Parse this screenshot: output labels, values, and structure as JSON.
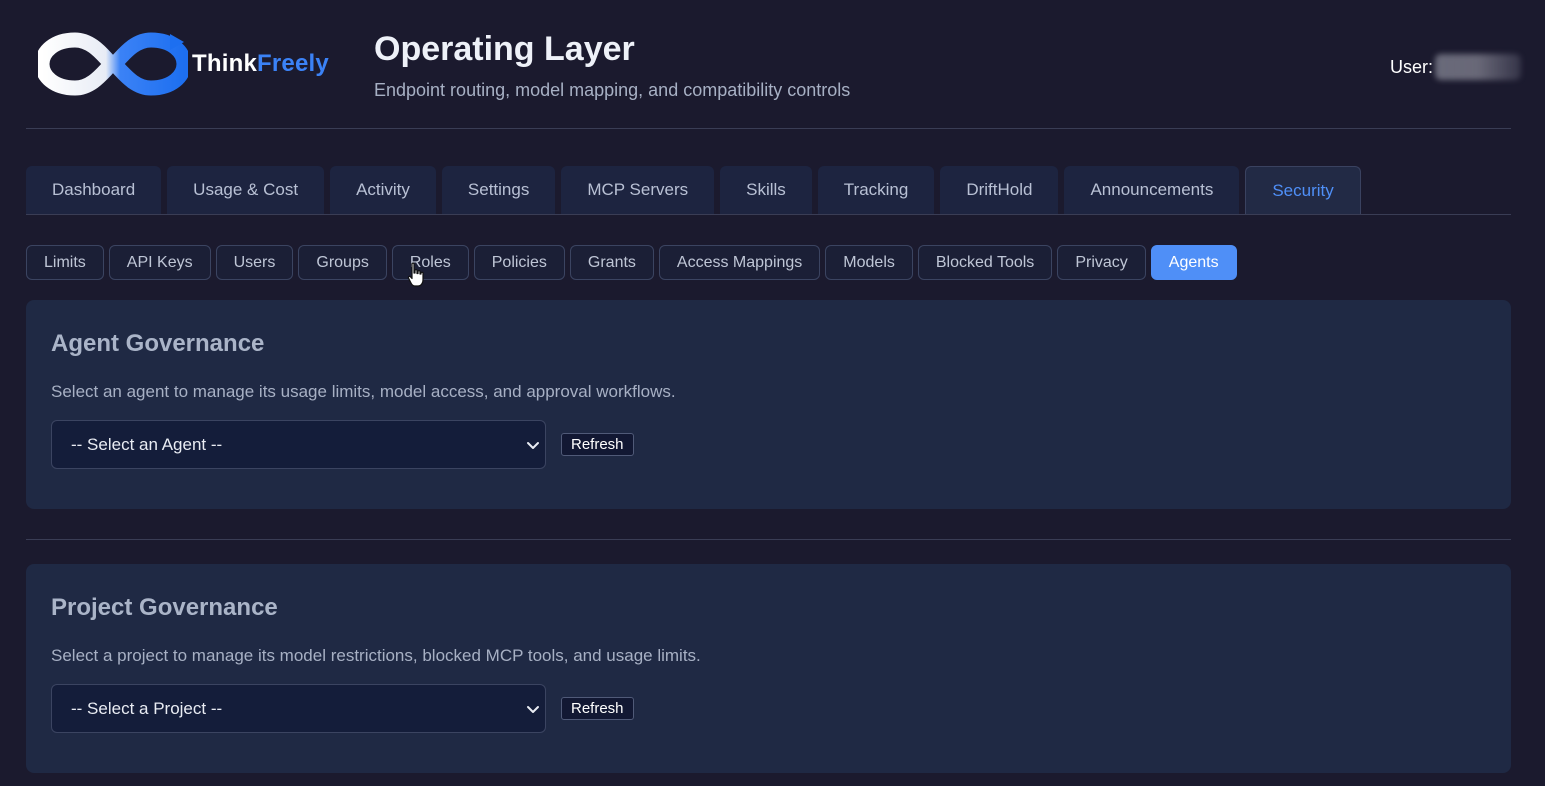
{
  "header": {
    "logo_text_a": "Think",
    "logo_text_b": "Freely",
    "title": "Operating Layer",
    "subtitle": "Endpoint routing, model mapping, and compatibility controls",
    "user_label": "User:"
  },
  "tabs": [
    {
      "label": "Dashboard"
    },
    {
      "label": "Usage & Cost"
    },
    {
      "label": "Activity"
    },
    {
      "label": "Settings"
    },
    {
      "label": "MCP Servers"
    },
    {
      "label": "Skills"
    },
    {
      "label": "Tracking"
    },
    {
      "label": "DriftHold"
    },
    {
      "label": "Announcements"
    },
    {
      "label": "Security"
    }
  ],
  "active_tab": "Security",
  "subtabs": [
    {
      "label": "Limits"
    },
    {
      "label": "API Keys"
    },
    {
      "label": "Users"
    },
    {
      "label": "Groups"
    },
    {
      "label": "Roles"
    },
    {
      "label": "Policies"
    },
    {
      "label": "Grants"
    },
    {
      "label": "Access Mappings"
    },
    {
      "label": "Models"
    },
    {
      "label": "Blocked Tools"
    },
    {
      "label": "Privacy"
    },
    {
      "label": "Agents"
    }
  ],
  "active_subtab": "Agents",
  "agent_governance": {
    "title": "Agent Governance",
    "description": "Select an agent to manage its usage limits, model access, and approval workflows.",
    "select_value": "-- Select an Agent --",
    "refresh_label": "Refresh"
  },
  "project_governance": {
    "title": "Project Governance",
    "description": "Select a project to manage its model restrictions, blocked MCP tools, and usage limits.",
    "select_value": "-- Select a Project --",
    "refresh_label": "Refresh"
  },
  "colors": {
    "background": "#1b1a2e",
    "panel": "#1f2944",
    "accent": "#4f8ff7",
    "logo_blue": "#3b82f6"
  },
  "icons": {
    "logo": "infinity-logo-icon",
    "select_chevron": "chevron-down-icon",
    "cursor": "hand-pointer-icon"
  }
}
